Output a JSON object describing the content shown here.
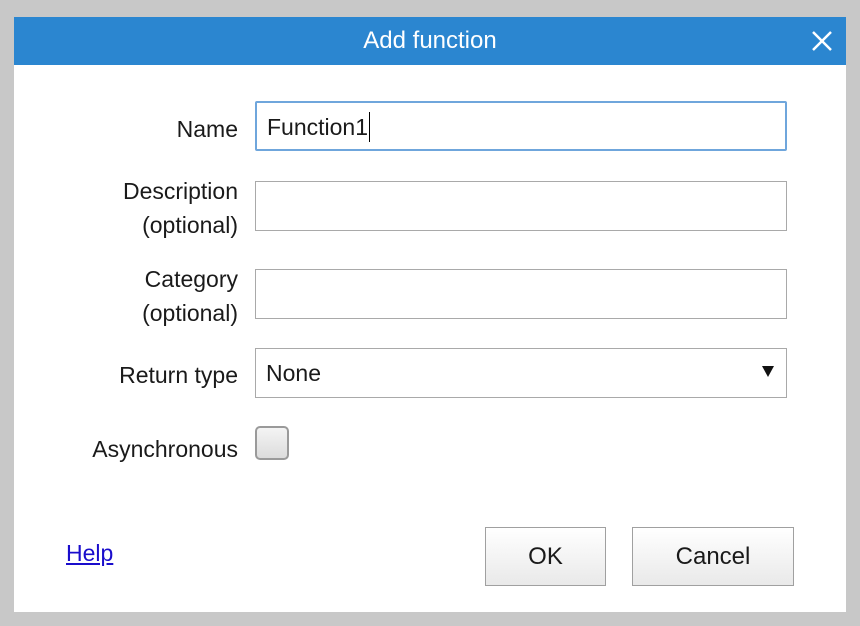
{
  "dialog": {
    "title": "Add function",
    "close_icon": "close-icon"
  },
  "form": {
    "name_label": "Name",
    "name_value": "Function1",
    "description_label_line1": "Description",
    "description_label_line2": "(optional)",
    "description_value": "",
    "category_label_line1": "Category",
    "category_label_line2": "(optional)",
    "category_value": "",
    "return_type_label": "Return type",
    "return_type_value": "None",
    "asynchronous_label": "Asynchronous",
    "asynchronous_checked": false
  },
  "footer": {
    "help_label": "Help",
    "ok_label": "OK",
    "cancel_label": "Cancel"
  },
  "colors": {
    "titlebar": "#2b86d0",
    "focus_border": "#6fa6dc",
    "link": "#1a0dcc"
  }
}
